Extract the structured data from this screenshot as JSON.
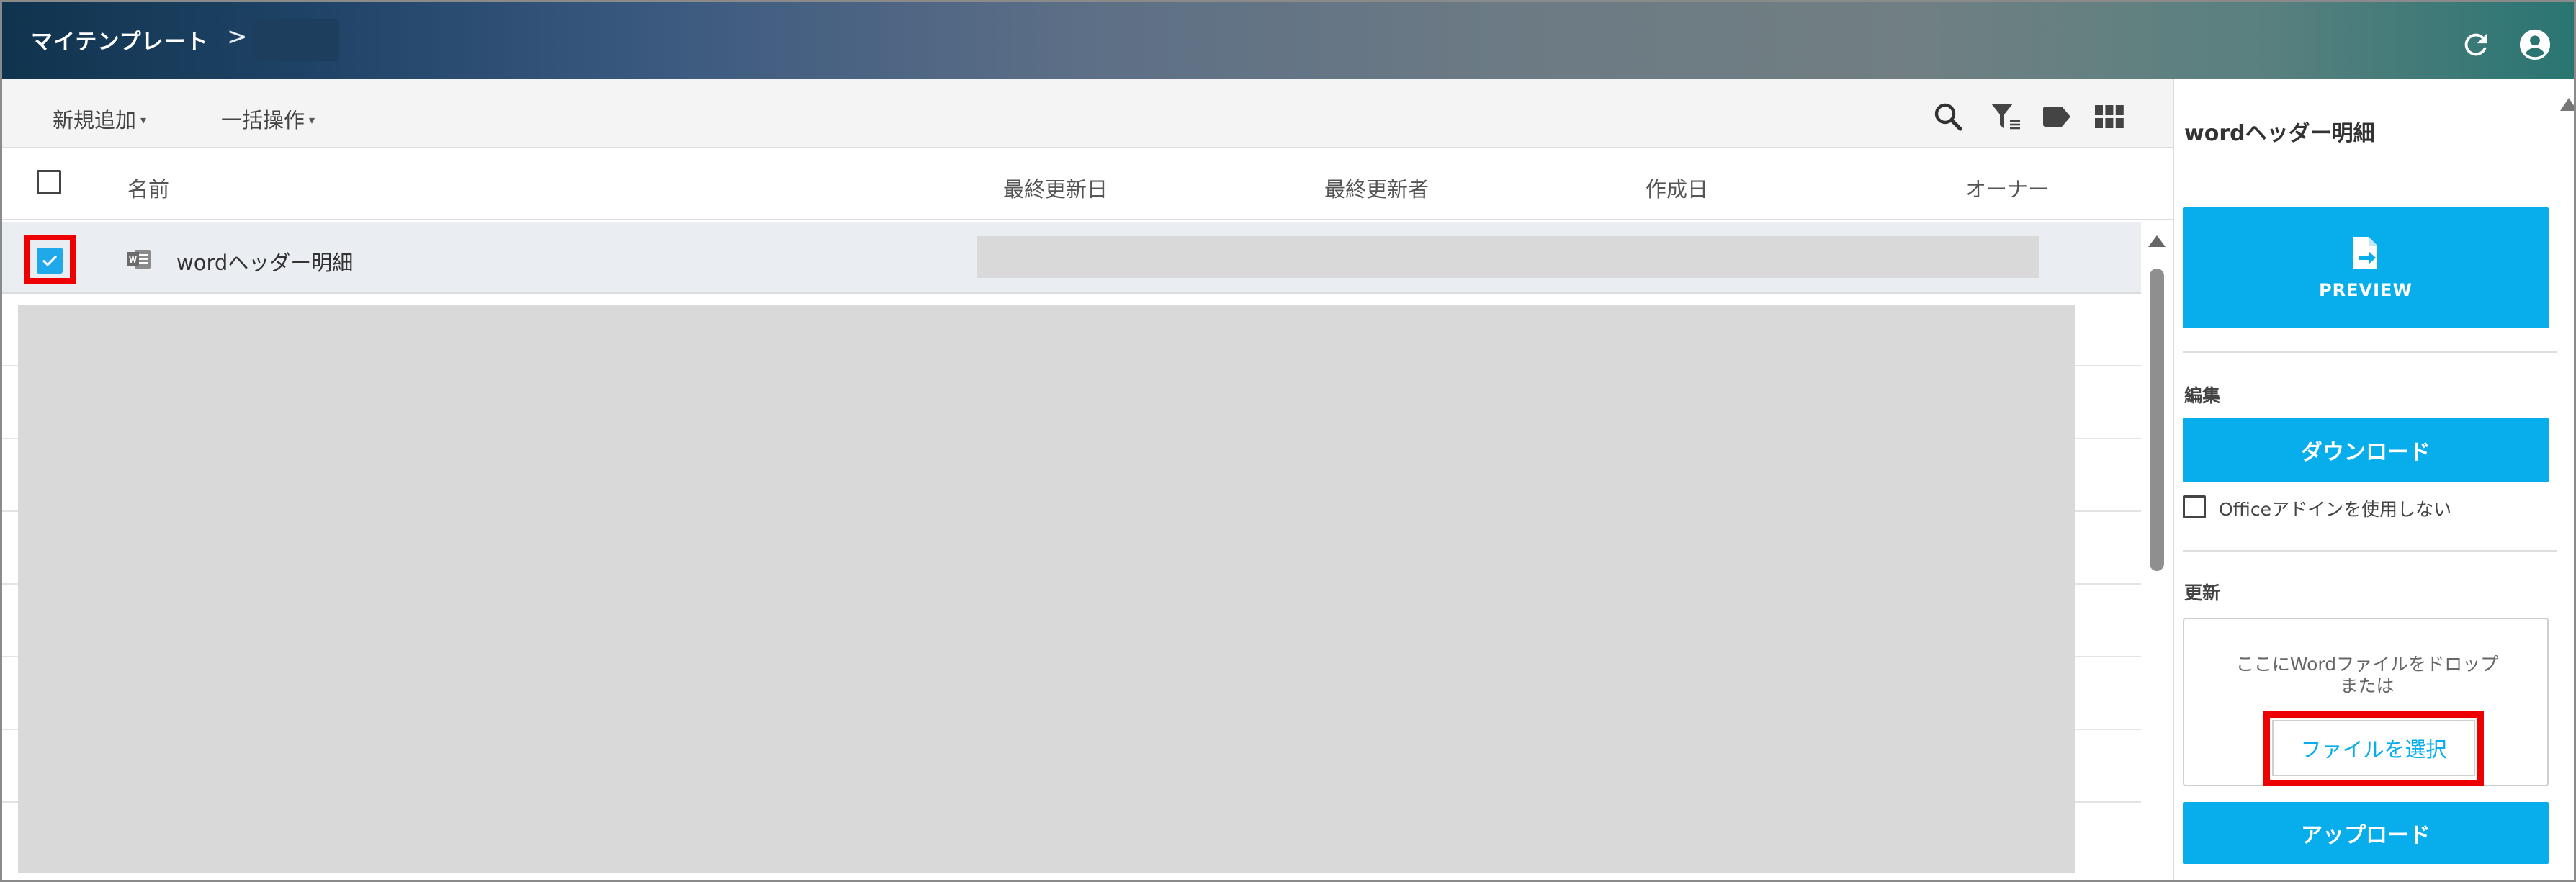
{
  "colors": {
    "accent": "#08aeec",
    "highlight": "#ee0000",
    "header_start": "#10344e",
    "header_end": "#2a7572"
  },
  "header": {
    "title": "マイテンプレート",
    "chevron": ">",
    "icons": {
      "refresh": "refresh-icon",
      "account": "account-icon"
    }
  },
  "toolbar": {
    "new_add_label": "新規追加",
    "bulk_ops_label": "一括操作",
    "caret": "▾",
    "icons": [
      "search-icon",
      "filter-icon",
      "tag-icon",
      "grid-view-icon"
    ]
  },
  "table": {
    "columns": [
      "名前",
      "最終更新日",
      "最終更新者",
      "作成日",
      "オーナー"
    ],
    "rows": [
      {
        "name": "wordヘッダー明細",
        "checked": true,
        "icon": "word-file-icon"
      }
    ]
  },
  "panel": {
    "title": "wordヘッダー明細",
    "preview_label": "PREVIEW",
    "edit_section": "編集",
    "download_label": "ダウンロード",
    "office_addin_label": "Officeアドインを使用しない",
    "update_section": "更新",
    "drop_line1": "ここにWordファイルをドロップ",
    "drop_line2": "または",
    "choose_file_label": "ファイルを選択",
    "upload_label": "アップロード"
  }
}
